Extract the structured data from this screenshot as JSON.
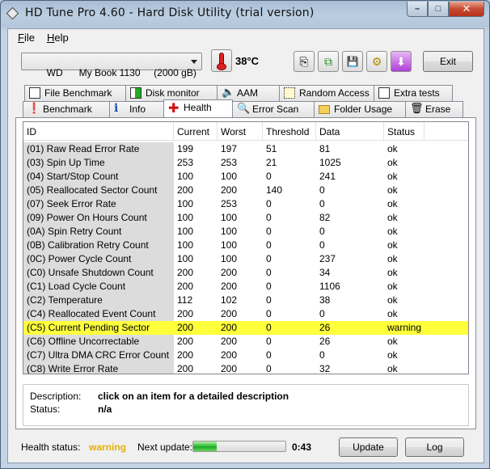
{
  "window": {
    "title": "HD Tune Pro 4.60 - Hard Disk Utility (trial version)"
  },
  "menu": [
    {
      "label": "File",
      "accel": "F",
      "rest": "ile"
    },
    {
      "label": "Help",
      "accel": "H",
      "rest": "elp"
    }
  ],
  "toolbar": {
    "drive": "WD      My Book 1130     (2000 gB)",
    "temperature": "38°C",
    "buttons": [
      {
        "name": "copy-text-icon",
        "glyph": "⎘"
      },
      {
        "name": "copy-screenshot-icon",
        "glyph": "⧉"
      },
      {
        "name": "save-icon",
        "glyph": "💾"
      },
      {
        "name": "options-icon",
        "glyph": "⚙"
      },
      {
        "name": "download-icon",
        "glyph": "⬇"
      }
    ],
    "exit_label": "Exit"
  },
  "tabs_top": [
    "File Benchmark",
    "Disk monitor",
    "AAM",
    "Random Access",
    "Extra tests"
  ],
  "tabs_bottom": [
    "Benchmark",
    "Info",
    "Health",
    "Error Scan",
    "Folder Usage",
    "Erase"
  ],
  "active_tab": "Health",
  "columns": [
    "ID",
    "Current",
    "Worst",
    "Threshold",
    "Data",
    "Status"
  ],
  "rows": [
    [
      "(01) Raw Read Error Rate",
      "199",
      "197",
      "51",
      "81",
      "ok"
    ],
    [
      "(03) Spin Up Time",
      "253",
      "253",
      "21",
      "1025",
      "ok"
    ],
    [
      "(04) Start/Stop Count",
      "100",
      "100",
      "0",
      "241",
      "ok"
    ],
    [
      "(05) Reallocated Sector Count",
      "200",
      "200",
      "140",
      "0",
      "ok"
    ],
    [
      "(07) Seek Error Rate",
      "100",
      "253",
      "0",
      "0",
      "ok"
    ],
    [
      "(09) Power On Hours Count",
      "100",
      "100",
      "0",
      "82",
      "ok"
    ],
    [
      "(0A) Spin Retry Count",
      "100",
      "100",
      "0",
      "0",
      "ok"
    ],
    [
      "(0B) Calibration Retry Count",
      "100",
      "100",
      "0",
      "0",
      "ok"
    ],
    [
      "(0C) Power Cycle Count",
      "100",
      "100",
      "0",
      "237",
      "ok"
    ],
    [
      "(C0) Unsafe Shutdown Count",
      "200",
      "200",
      "0",
      "34",
      "ok"
    ],
    [
      "(C1) Load Cycle Count",
      "200",
      "200",
      "0",
      "1106",
      "ok"
    ],
    [
      "(C2) Temperature",
      "112",
      "102",
      "0",
      "38",
      "ok"
    ],
    [
      "(C4) Reallocated Event Count",
      "200",
      "200",
      "0",
      "0",
      "ok"
    ],
    [
      "(C5) Current Pending Sector",
      "200",
      "200",
      "0",
      "26",
      "warning"
    ],
    [
      "(C6) Offline Uncorrectable",
      "200",
      "200",
      "0",
      "26",
      "ok"
    ],
    [
      "(C7) Ultra DMA CRC Error Count",
      "200",
      "200",
      "0",
      "0",
      "ok"
    ],
    [
      "(C8) Write Error Rate",
      "200",
      "200",
      "0",
      "32",
      "ok"
    ]
  ],
  "highlight_color": "#ffff3c",
  "description": {
    "label": "Description:",
    "value": "click on an item for a detailed description"
  },
  "status": {
    "label": "Status:",
    "value": "n/a"
  },
  "footer": {
    "health_label": "Health status:",
    "health_value": "warning",
    "health_color": "#e5b000",
    "next_update_label": "Next update:",
    "progress_fraction": 0.25,
    "countdown": "0:43",
    "update_label": "Update",
    "log_label": "Log"
  }
}
